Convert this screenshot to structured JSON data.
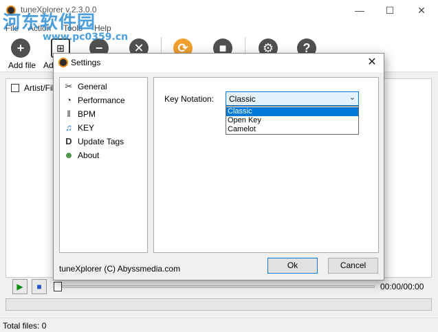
{
  "main_window": {
    "title": "tuneXplorer v.2.3.0.0",
    "menu": [
      "File",
      "Action",
      "Tools",
      "Help"
    ],
    "toolbar": [
      {
        "label": "Add file",
        "icon": "plus-icon"
      },
      {
        "label": "Ad",
        "icon": "add-folder-icon"
      },
      {
        "label": "",
        "icon": "minus-icon"
      },
      {
        "label": "",
        "icon": "x-icon"
      },
      {
        "label": "",
        "icon": "refresh-icon"
      },
      {
        "label": "",
        "icon": "stop-icon"
      },
      {
        "label": "",
        "icon": "gear-icon"
      },
      {
        "label": "",
        "icon": "help-icon"
      }
    ],
    "list_header": "Artist/File",
    "player_time": "00:00/00:00",
    "status": "Total files: 0"
  },
  "watermark": {
    "text": "河东软件园",
    "url": "www.pc0359.cn"
  },
  "settings_dialog": {
    "title": "Settings",
    "nav": [
      {
        "label": "General",
        "icon": "tools-icon"
      },
      {
        "label": "Performance",
        "icon": "gauge-icon"
      },
      {
        "label": "BPM",
        "icon": "waveform-icon"
      },
      {
        "label": "KEY",
        "icon": "music-note-icon"
      },
      {
        "label": "Update Tags",
        "icon": "tag-icon"
      },
      {
        "label": "About",
        "icon": "user-icon"
      }
    ],
    "key_notation": {
      "label": "Key Notation:",
      "value": "Classic",
      "options": [
        "Classic",
        "Open Key",
        "Camelot"
      ]
    },
    "footer": "tuneXplorer (C) Abyssmedia.com",
    "ok_label": "Ok",
    "cancel_label": "Cancel"
  },
  "colors": {
    "accent": "#0078d7",
    "watermark": "#2d8fd6"
  }
}
